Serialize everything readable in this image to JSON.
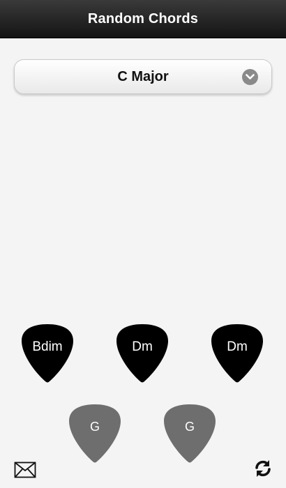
{
  "header": {
    "title": "Random Chords"
  },
  "key_selector": {
    "value": "C Major",
    "icon": "chevron-down-icon"
  },
  "chords": {
    "row1": [
      {
        "label": "Bdim",
        "color": "#000000"
      },
      {
        "label": "Dm",
        "color": "#000000"
      },
      {
        "label": "Dm",
        "color": "#000000"
      }
    ],
    "row2": [
      {
        "label": "G",
        "color": "#6e6e6e"
      },
      {
        "label": "G",
        "color": "#6e6e6e"
      }
    ]
  },
  "footer": {
    "left_icon": "mail-icon",
    "right_icon": "refresh-icon"
  }
}
